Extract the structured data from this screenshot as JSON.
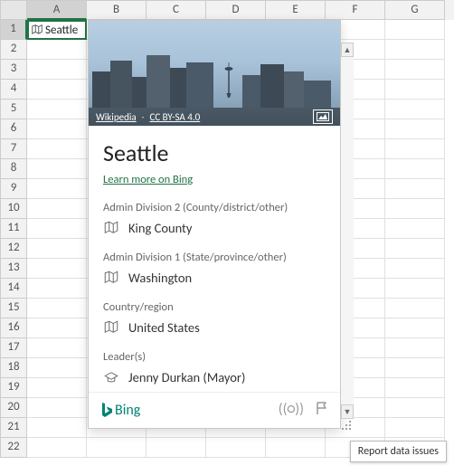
{
  "columns": [
    "A",
    "B",
    "C",
    "D",
    "E",
    "F",
    "G"
  ],
  "active_cell": {
    "col": "A",
    "row": 1,
    "value": "Seattle"
  },
  "card": {
    "attribution": {
      "source": "Wikipedia",
      "license": "CC BY-SA 4.0"
    },
    "title": "Seattle",
    "learn_more": "Learn more on Bing",
    "fields": [
      {
        "label": "Admin Division 2 (County/district/other)",
        "icon": "geo",
        "value": "King County"
      },
      {
        "label": "Admin Division 1 (State/province/other)",
        "icon": "geo",
        "value": "Washington"
      },
      {
        "label": "Country/region",
        "icon": "geo",
        "value": "United States"
      },
      {
        "label": "Leader(s)",
        "icon": "hat",
        "value": "Jenny Durkan (Mayor)"
      }
    ],
    "footer": {
      "brand": "Bing"
    }
  },
  "tooltip": "Report data issues"
}
